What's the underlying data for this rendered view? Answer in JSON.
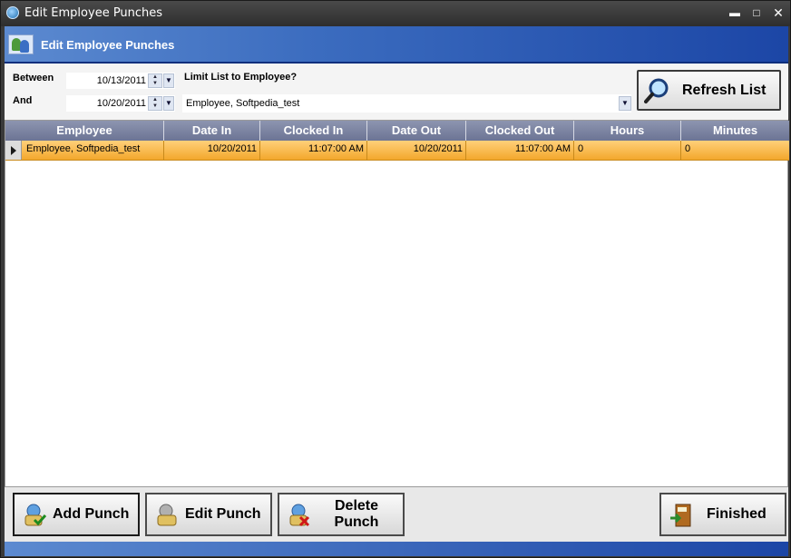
{
  "window": {
    "title": "Edit Employee Punches"
  },
  "header": {
    "title": "Edit Employee Punches"
  },
  "filters": {
    "between_label": "Between",
    "and_label": "And",
    "start_date": "10/13/2011",
    "end_date": "10/20/2011",
    "limit_label": "Limit List to Employee?",
    "employee_selected": "Employee, Softpedia_test",
    "refresh_label": "Refresh List"
  },
  "grid": {
    "columns": [
      "Employee",
      "Date In",
      "Clocked In",
      "Date Out",
      "Clocked Out",
      "Hours",
      "Minutes"
    ],
    "rows": [
      {
        "employee": "Employee, Softpedia_test",
        "date_in": "10/20/2011",
        "clocked_in": "11:07:00 AM",
        "date_out": "10/20/2011",
        "clocked_out": "11:07:00 AM",
        "hours": "0",
        "minutes": "0"
      }
    ]
  },
  "buttons": {
    "add": "Add Punch",
    "edit": "Edit Punch",
    "delete_line1": "Delete",
    "delete_line2": "Punch",
    "finished": "Finished"
  },
  "colors": {
    "header_blue": "#1c46a6",
    "selected_row": "#f3a72c",
    "grid_header": "#7a82a0"
  }
}
